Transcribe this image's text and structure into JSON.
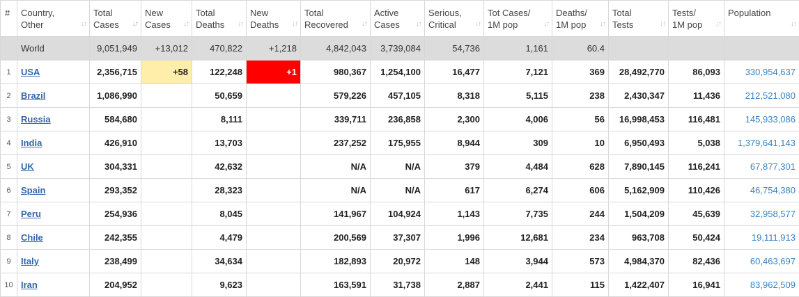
{
  "headers": [
    {
      "key": "num",
      "lines": [
        "#",
        ""
      ]
    },
    {
      "key": "country",
      "lines": [
        "Country,",
        "Other"
      ]
    },
    {
      "key": "total_cases",
      "lines": [
        "Total",
        "Cases"
      ]
    },
    {
      "key": "new_cases",
      "lines": [
        "New",
        "Cases"
      ]
    },
    {
      "key": "total_deaths",
      "lines": [
        "Total",
        "Deaths"
      ]
    },
    {
      "key": "new_deaths",
      "lines": [
        "New",
        "Deaths"
      ]
    },
    {
      "key": "total_recovered",
      "lines": [
        "Total",
        "Recovered"
      ]
    },
    {
      "key": "active_cases",
      "lines": [
        "Active",
        "Cases"
      ]
    },
    {
      "key": "serious",
      "lines": [
        "Serious,",
        "Critical"
      ]
    },
    {
      "key": "cases_per_m",
      "lines": [
        "Tot Cases/",
        "1M pop"
      ]
    },
    {
      "key": "deaths_per_m",
      "lines": [
        "Deaths/",
        "1M pop"
      ]
    },
    {
      "key": "total_tests",
      "lines": [
        "Total",
        "Tests"
      ]
    },
    {
      "key": "tests_per_m",
      "lines": [
        "Tests/",
        "1M pop"
      ]
    },
    {
      "key": "population",
      "lines": [
        "Population",
        ""
      ]
    }
  ],
  "sort_icon": "↓↑",
  "world": {
    "label": "World",
    "total_cases": "9,051,949",
    "new_cases": "+13,012",
    "total_deaths": "470,822",
    "new_deaths": "+1,218",
    "total_recovered": "4,842,043",
    "active_cases": "3,739,084",
    "serious": "54,736",
    "cases_per_m": "1,161",
    "deaths_per_m": "60.4",
    "total_tests": "",
    "tests_per_m": "",
    "population": ""
  },
  "rows": [
    {
      "num": "1",
      "country": "USA",
      "total_cases": "2,356,715",
      "new_cases": "+58",
      "total_deaths": "122,248",
      "new_deaths": "+1",
      "total_recovered": "980,367",
      "active_cases": "1,254,100",
      "serious": "16,477",
      "cases_per_m": "7,121",
      "deaths_per_m": "369",
      "total_tests": "28,492,770",
      "tests_per_m": "86,093",
      "population": "330,954,637"
    },
    {
      "num": "2",
      "country": "Brazil",
      "total_cases": "1,086,990",
      "new_cases": "",
      "total_deaths": "50,659",
      "new_deaths": "",
      "total_recovered": "579,226",
      "active_cases": "457,105",
      "serious": "8,318",
      "cases_per_m": "5,115",
      "deaths_per_m": "238",
      "total_tests": "2,430,347",
      "tests_per_m": "11,436",
      "population": "212,521,080"
    },
    {
      "num": "3",
      "country": "Russia",
      "total_cases": "584,680",
      "new_cases": "",
      "total_deaths": "8,111",
      "new_deaths": "",
      "total_recovered": "339,711",
      "active_cases": "236,858",
      "serious": "2,300",
      "cases_per_m": "4,006",
      "deaths_per_m": "56",
      "total_tests": "16,998,453",
      "tests_per_m": "116,481",
      "population": "145,933,086"
    },
    {
      "num": "4",
      "country": "India",
      "total_cases": "426,910",
      "new_cases": "",
      "total_deaths": "13,703",
      "new_deaths": "",
      "total_recovered": "237,252",
      "active_cases": "175,955",
      "serious": "8,944",
      "cases_per_m": "309",
      "deaths_per_m": "10",
      "total_tests": "6,950,493",
      "tests_per_m": "5,038",
      "population": "1,379,641,143"
    },
    {
      "num": "5",
      "country": "UK",
      "total_cases": "304,331",
      "new_cases": "",
      "total_deaths": "42,632",
      "new_deaths": "",
      "total_recovered": "N/A",
      "active_cases": "N/A",
      "serious": "379",
      "cases_per_m": "4,484",
      "deaths_per_m": "628",
      "total_tests": "7,890,145",
      "tests_per_m": "116,241",
      "population": "67,877,301"
    },
    {
      "num": "6",
      "country": "Spain",
      "total_cases": "293,352",
      "new_cases": "",
      "total_deaths": "28,323",
      "new_deaths": "",
      "total_recovered": "N/A",
      "active_cases": "N/A",
      "serious": "617",
      "cases_per_m": "6,274",
      "deaths_per_m": "606",
      "total_tests": "5,162,909",
      "tests_per_m": "110,426",
      "population": "46,754,380"
    },
    {
      "num": "7",
      "country": "Peru",
      "total_cases": "254,936",
      "new_cases": "",
      "total_deaths": "8,045",
      "new_deaths": "",
      "total_recovered": "141,967",
      "active_cases": "104,924",
      "serious": "1,143",
      "cases_per_m": "7,735",
      "deaths_per_m": "244",
      "total_tests": "1,504,209",
      "tests_per_m": "45,639",
      "population": "32,958,577"
    },
    {
      "num": "8",
      "country": "Chile",
      "total_cases": "242,355",
      "new_cases": "",
      "total_deaths": "4,479",
      "new_deaths": "",
      "total_recovered": "200,569",
      "active_cases": "37,307",
      "serious": "1,996",
      "cases_per_m": "12,681",
      "deaths_per_m": "234",
      "total_tests": "963,708",
      "tests_per_m": "50,424",
      "population": "19,111,913"
    },
    {
      "num": "9",
      "country": "Italy",
      "total_cases": "238,499",
      "new_cases": "",
      "total_deaths": "34,634",
      "new_deaths": "",
      "total_recovered": "182,893",
      "active_cases": "20,972",
      "serious": "148",
      "cases_per_m": "3,944",
      "deaths_per_m": "573",
      "total_tests": "4,984,370",
      "tests_per_m": "82,436",
      "population": "60,463,697"
    },
    {
      "num": "10",
      "country": "Iran",
      "total_cases": "204,952",
      "new_cases": "",
      "total_deaths": "9,623",
      "new_deaths": "",
      "total_recovered": "163,591",
      "active_cases": "31,738",
      "serious": "2,887",
      "cases_per_m": "2,441",
      "deaths_per_m": "115",
      "total_tests": "1,422,407",
      "tests_per_m": "16,941",
      "population": "83,962,509"
    }
  ],
  "colors": {
    "new_cases_highlight": "#ffeeaa",
    "new_deaths_highlight": "#ff0000",
    "world_row": "#dcdcdc",
    "link": "#3366aa",
    "population": "#3a83c4"
  }
}
